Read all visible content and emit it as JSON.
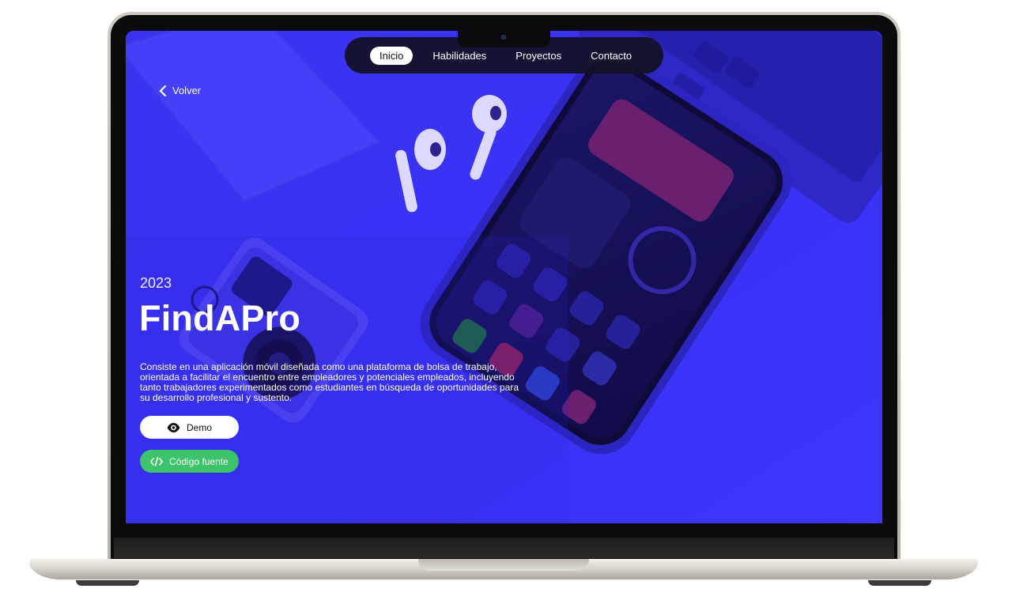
{
  "nav": {
    "items": [
      {
        "label": "Inicio",
        "active": true
      },
      {
        "label": "Habilidades",
        "active": false
      },
      {
        "label": "Proyectos",
        "active": false
      },
      {
        "label": "Contacto",
        "active": false
      }
    ]
  },
  "back": {
    "label": "Volver",
    "icon": "chevron-left-icon"
  },
  "project": {
    "year": "2023",
    "title": "FindAPro",
    "description": "Consiste en una aplicación móvil diseñada como una plataforma de bolsa de trabajo, orientada a facilitar el encuentro entre empleadores y potenciales empleados, incluyendo tanto trabajadores experimentados como estudiantes en búsqueda de oportunidades para su desarrollo profesional y sustento."
  },
  "buttons": {
    "demo": {
      "label": "Demo",
      "icon": "eye-icon"
    },
    "code": {
      "label": "Código fuente",
      "icon": "code-icon"
    }
  },
  "colors": {
    "screen_bg": "#3a33f5",
    "nav_bg": "#121126",
    "accent_green": "#3dc36b",
    "white": "#ffffff"
  }
}
